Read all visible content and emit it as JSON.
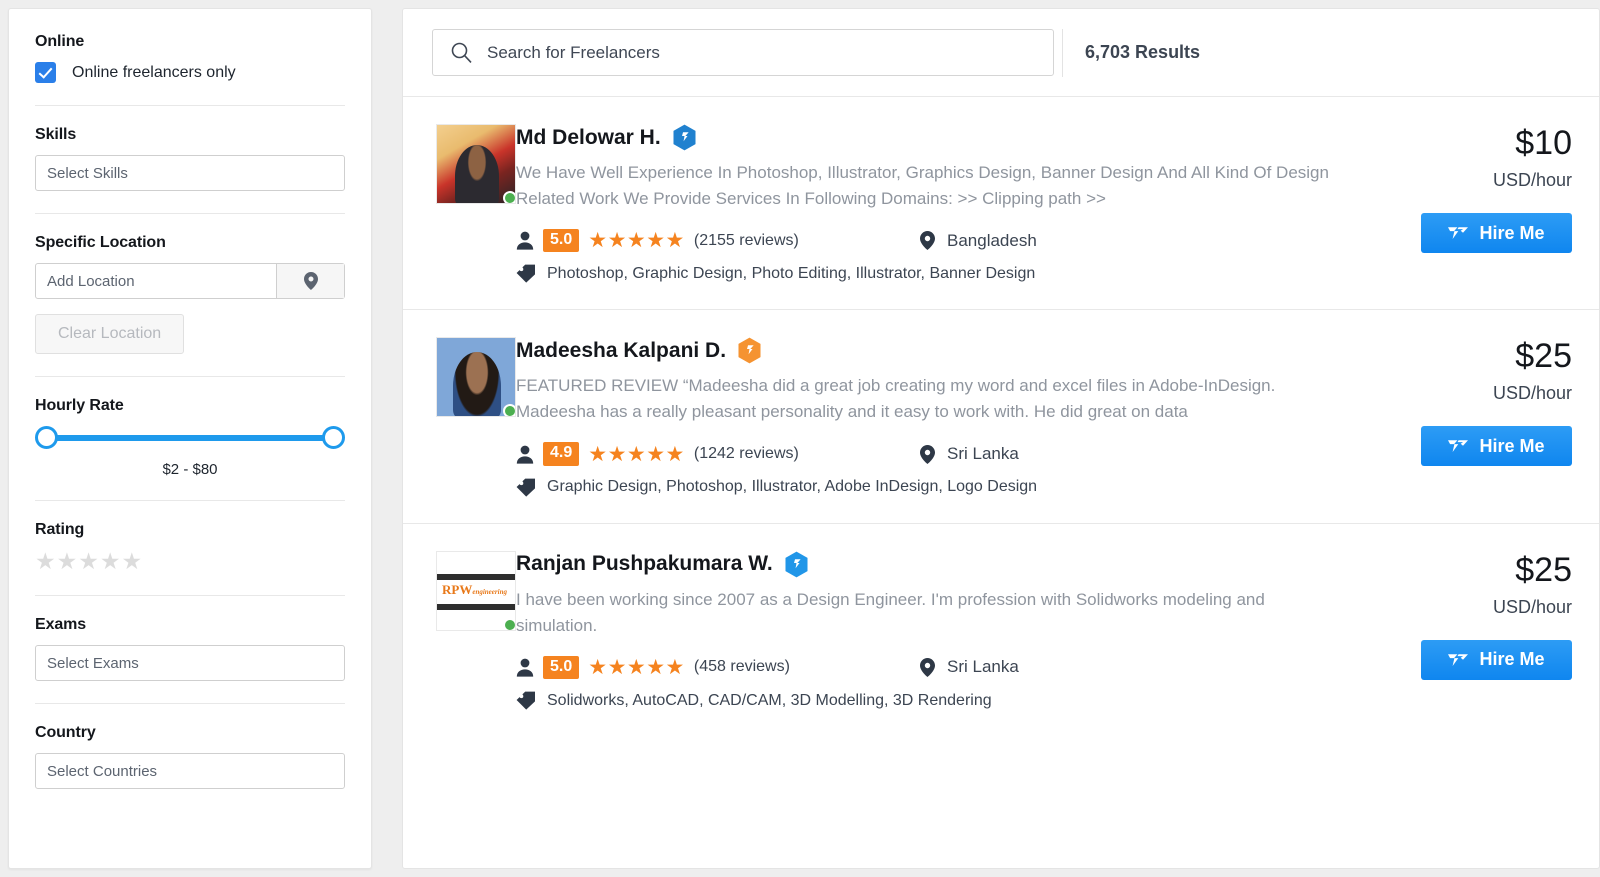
{
  "sidebar": {
    "sections": [
      {
        "title": "Online",
        "kind": "checkbox",
        "checkbox_label": "Online freelancers only",
        "checked": true
      },
      {
        "title": "Skills",
        "kind": "select",
        "placeholder": "Select Skills"
      },
      {
        "title": "Specific Location",
        "kind": "location",
        "placeholder": "Add Location",
        "pin_icon": "map-pin-icon",
        "clear_label": "Clear Location"
      },
      {
        "title": "Hourly Rate",
        "kind": "slider",
        "range_text": "$2 - $80",
        "min": 2,
        "max": 80
      },
      {
        "title": "Rating",
        "kind": "stars",
        "stars": "★★★★★",
        "value": 0
      },
      {
        "title": "Exams",
        "kind": "select",
        "placeholder": "Select Exams"
      },
      {
        "title": "Country",
        "kind": "select",
        "placeholder": "Select Countries"
      }
    ]
  },
  "search": {
    "icon": "search-icon",
    "placeholder": "Search for Freelancers",
    "value": "",
    "results_count": "6,703 Results"
  },
  "results": [
    {
      "name": "Md Delowar H.",
      "badge": "verified-hexagon-badge",
      "badge_color": "#2081cf",
      "avatar": "av1",
      "online": true,
      "tagline": "We Have Well Experience In Photoshop, Illustrator, Graphics Design, Banner Design And All Kind Of Design Related Work We Provide Services In Following Domains: >> Clipping path >>",
      "rating": "5.0",
      "stars": "★★★★★",
      "reviews": "(2155 reviews)",
      "location": "Bangladesh",
      "skills": "Photoshop, Graphic Design, Photo Editing, Illustrator, Banner Design",
      "price": "$10",
      "price_unit": "USD/hour",
      "hire_label": "Hire Me"
    },
    {
      "name": "Madeesha Kalpani D.",
      "badge": "preferred-hexagon-badge",
      "badge_color": "#f59331",
      "avatar": "av2",
      "online": true,
      "tagline": "FEATURED REVIEW “Madeesha did a great job creating my word and excel files in Adobe-InDesign. Madeesha has a really pleasant personality and it easy to work with. He did great on data",
      "rating": "4.9",
      "stars": "★★★★★",
      "reviews": "(1242 reviews)",
      "location": "Sri Lanka",
      "skills": "Graphic Design, Photoshop, Illustrator, Adobe InDesign, Logo Design",
      "price": "$25",
      "price_unit": "USD/hour",
      "hire_label": "Hire Me"
    },
    {
      "name": "Ranjan Pushpakumara W.",
      "badge": "verified-hexagon-badge",
      "badge_color": "#2196e8",
      "avatar": "av3",
      "online": true,
      "tagline": "I have been working since 2007 as a Design Engineer. I'm profession with Solidworks modeling and simulation.",
      "rating": "5.0",
      "stars": "★★★★★",
      "reviews": "(458 reviews)",
      "location": "Sri Lanka",
      "skills": "Solidworks, AutoCAD, CAD/CAM, 3D Modelling, 3D Rendering",
      "price": "$25",
      "price_unit": "USD/hour",
      "hire_label": "Hire Me"
    }
  ],
  "colors": {
    "accent_blue": "#2a7fe9",
    "accent_orange": "#f5831f",
    "online_green": "#4caf50",
    "slider_blue": "#1e9aec",
    "text_dark": "#14171c",
    "text_muted": "#8f959e"
  },
  "icons": {
    "search": "search-icon",
    "map_pin": "map-pin-icon",
    "person": "person-icon",
    "tag": "tag-icon",
    "location_pin": "location-pin-icon",
    "bird": "freelancer-bird-icon"
  }
}
